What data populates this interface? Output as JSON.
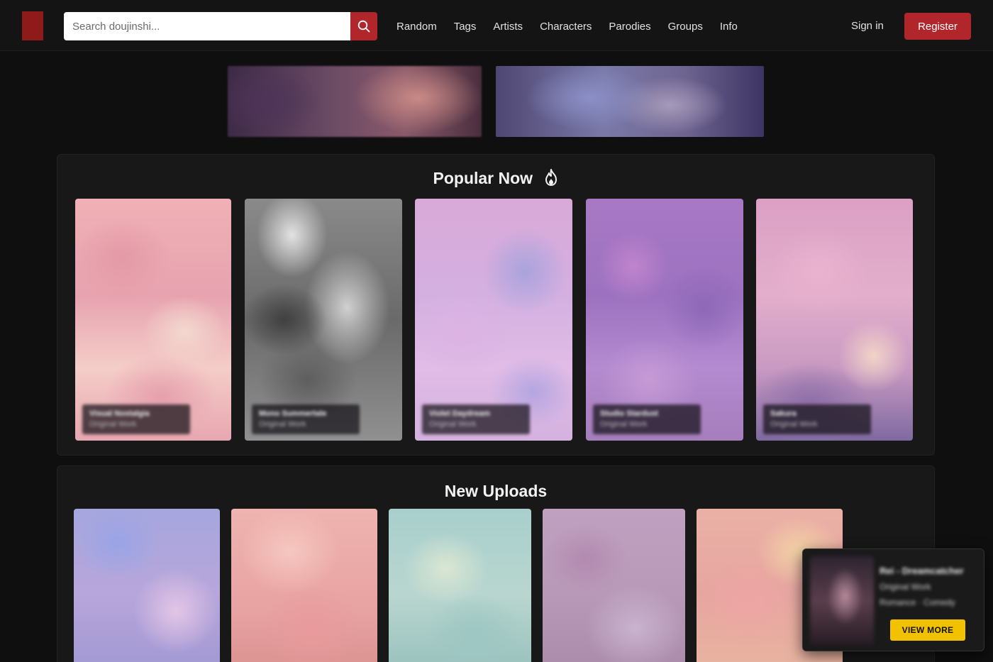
{
  "header": {
    "search": {
      "placeholder": "Search doujinshi...",
      "value": ""
    },
    "nav": [
      "Random",
      "Tags",
      "Artists",
      "Characters",
      "Parodies",
      "Groups",
      "Info"
    ],
    "sign_in": "Sign in",
    "register": "Register"
  },
  "popular": {
    "title": "Popular Now",
    "cards": [
      {
        "title": "Visual Nostalgia",
        "subtitle": "Original Work"
      },
      {
        "title": "Mono Summertale",
        "subtitle": "Original Work"
      },
      {
        "title": "Violet Daydream",
        "subtitle": "Original Work"
      },
      {
        "title": "Studio Stardust",
        "subtitle": "Original Work"
      },
      {
        "title": "Sakura",
        "subtitle": "Original Work"
      }
    ]
  },
  "new_uploads": {
    "title": "New Uploads"
  },
  "popup": {
    "title": "Rei - Dreamcatcher",
    "line1": "Original Work",
    "line2": "Romance · Comedy",
    "button": "VIEW MORE"
  },
  "colors": {
    "accent": "#b1262a",
    "popup_button": "#f2c200",
    "background": "#0f0f0f"
  }
}
